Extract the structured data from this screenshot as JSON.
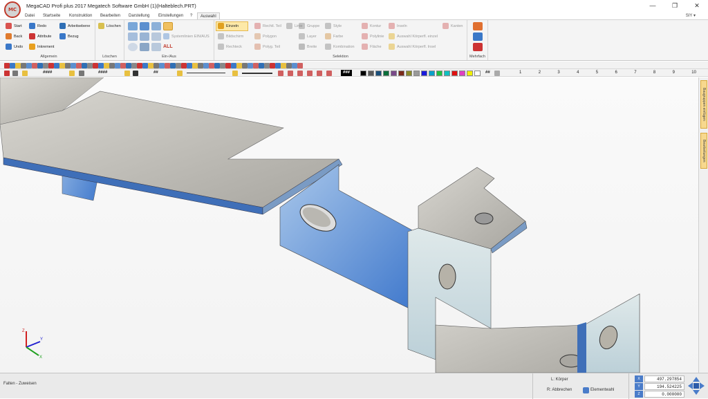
{
  "window": {
    "app_logo": "MC",
    "title": "MegaCAD Profi plus 2017  Megatech Software GmbH (1)(Halteblech.PRT)",
    "minimize": "—",
    "maximize": "❐",
    "close": "✕"
  },
  "menu": {
    "tabs": [
      "Datei",
      "Startseite",
      "Konstruktion",
      "Bearbeiten",
      "Darstellung",
      "Einstellungen",
      "?",
      "Auswahl"
    ],
    "active_tab": "Auswahl",
    "right_label": "SIY ▾"
  },
  "ribbon": {
    "allgemein": {
      "label": "Allgemein",
      "items": [
        "Start",
        "Redo",
        "Arbeitsebene",
        "Back",
        "Attribute",
        "Bezug",
        "Undo",
        "Inkrement"
      ]
    },
    "loeschen": {
      "label": "Löschen",
      "items": [
        "Löschen"
      ]
    },
    "ein_aus": {
      "label": "Ein-/Aus",
      "items": [
        "Systemlinien EIN/AUS",
        "ALL"
      ]
    },
    "selektion": {
      "label": "Selektion",
      "items": [
        "Einzeln",
        "Bildschirm",
        "Rechteck",
        "Rechtl. Teil",
        "Polygon",
        "Polyg. Teil",
        "Linie",
        "Gruppe",
        "Layer",
        "Breite",
        "Style",
        "Farbe",
        "Kombination",
        "Kontur",
        "Polylinie",
        "Fläche",
        "Inseln",
        "Auswahl Körperfl. einzel",
        "Auswahl Körperfl. Insel",
        "Kanten"
      ]
    },
    "mehrfach": {
      "label": "Mehrfach"
    }
  },
  "toolbar": {
    "hash1": "####",
    "hash2": "####",
    "hash3": "##",
    "hash_color": "###",
    "hash_end": "##",
    "colors": [
      "#000000",
      "#5a5a5a",
      "#1a4f7a",
      "#0b6e3a",
      "#7a4a8a",
      "#7a2a1a",
      "#8a8a2a",
      "#9a9a9a",
      "#1a1adc",
      "#0aa0c8",
      "#20c040",
      "#10c0c0",
      "#e01010",
      "#e040c0",
      "#f0f000",
      "#ffffff"
    ],
    "scale_numbers": [
      "1",
      "2",
      "3",
      "4",
      "5",
      "6",
      "7",
      "8",
      "9",
      "10"
    ]
  },
  "side_panel": {
    "tab1": "Baugruppen einfügen",
    "tab2": "Bearbeitungen"
  },
  "status": {
    "left": "Falten - Zuweisen",
    "l_label": "L: Körper",
    "r_label": "R: Abbrechen",
    "element": "Elementwahl",
    "coords": [
      {
        "axis": "X",
        "value": "497.297854"
      },
      {
        "axis": "Y",
        "value": "194.524225"
      },
      {
        "axis": "Z",
        "value": "0.000000"
      }
    ]
  },
  "axes": {
    "x": "X",
    "y": "Y",
    "z": "Z"
  }
}
